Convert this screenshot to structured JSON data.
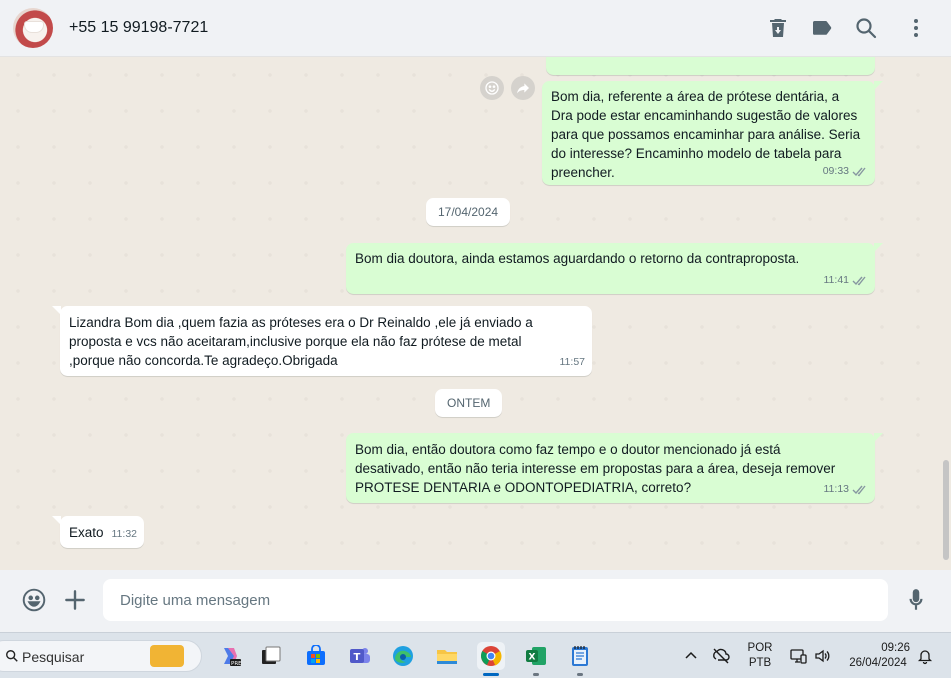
{
  "header": {
    "contact": "+55 15 99198-7721"
  },
  "messages": [
    {
      "type": "out",
      "text": "Bom dia, referente a área de prótese dentária, a\nDra pode estar encaminhando sugestão de valores\npara que possamos encaminhar para análise. Seria\ndo interesse? Encaminho modelo de tabela para\npreencher.",
      "time": "09:33"
    },
    {
      "type": "date",
      "text": "17/04/2024"
    },
    {
      "type": "out",
      "text": "Bom dia doutora, ainda estamos aguardando o retorno da contraproposta.",
      "time": "11:41"
    },
    {
      "type": "in",
      "text": "Lizandra Bom dia ,quem fazia as próteses era o Dr Reinaldo ,ele já enviado a\nproposta e vcs não aceitaram,inclusive porque ela não faz prótese de metal\n,porque não concorda.Te agradeço.Obrigada",
      "time": "11:57"
    },
    {
      "type": "date",
      "text": "ONTEM"
    },
    {
      "type": "out",
      "text": "Bom dia, então doutora como faz tempo e o doutor mencionado já está\ndesativado, então não teria interesse em propostas para a área, deseja remover\nPROTESE DENTARIA e ODONTOPEDIATRIA, correto?",
      "time": "11:13"
    },
    {
      "type": "in",
      "text": "Exato",
      "time": "11:32"
    }
  ],
  "composer": {
    "placeholder": "Digite uma mensagem"
  },
  "taskbar": {
    "search_label": "Pesquisar",
    "lang_top": "POR",
    "lang_bottom": "PTB",
    "time": "09:26",
    "date": "26/04/2024"
  },
  "colors": {
    "outgoing_bubble": "#d9fdd3",
    "incoming_bubble": "#ffffff",
    "chat_background": "#efeae2"
  }
}
